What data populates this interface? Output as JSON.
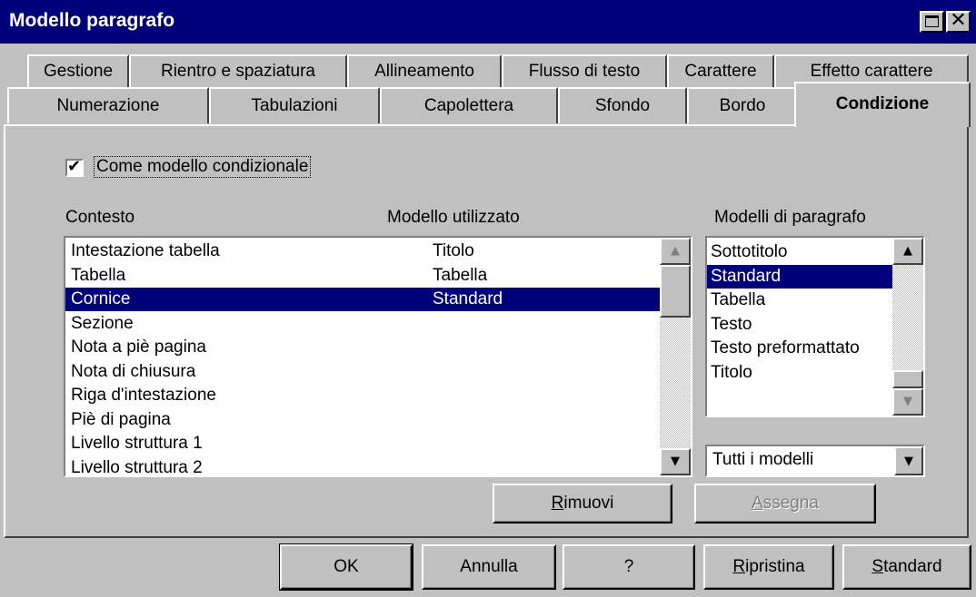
{
  "window": {
    "title": "Modello paragrafo",
    "close_glyph": "✕"
  },
  "tabs": {
    "row1": [
      "Gestione",
      "Rientro e spaziatura",
      "Allineamento",
      "Flusso di testo",
      "Carattere",
      "Effetto carattere"
    ],
    "row2": [
      "Numerazione",
      "Tabulazioni",
      "Capolettera",
      "Sfondo",
      "Bordo",
      "Condizione"
    ],
    "active": "Condizione"
  },
  "condition": {
    "checkbox": {
      "label": "Come modello condizionale",
      "checked": true,
      "mark": "✔"
    },
    "context_header": "Contesto",
    "used_style_header": "Modello utilizzato",
    "styles_header": "Modelli di paragrafo",
    "context_rows": [
      {
        "context": "Intestazione tabella",
        "style": "Titolo"
      },
      {
        "context": "Tabella",
        "style": "Tabella"
      },
      {
        "context": "Cornice",
        "style": "Standard"
      },
      {
        "context": "Sezione",
        "style": ""
      },
      {
        "context": "Nota a piè pagina",
        "style": ""
      },
      {
        "context": "Nota di chiusura",
        "style": ""
      },
      {
        "context": "Riga d'intestazione",
        "style": ""
      },
      {
        "context": "Piè di pagina",
        "style": ""
      },
      {
        "context": "Livello struttura 1",
        "style": ""
      },
      {
        "context": "Livello struttura 2",
        "style": ""
      }
    ],
    "selected_context": "Cornice",
    "paragraph_styles": [
      "Sottotitolo",
      "Standard",
      "Tabella",
      "Testo",
      "Testo preformattato",
      "Titolo"
    ],
    "selected_style": "Standard",
    "filter_value": "Tutti i modelli",
    "remove_label": "Rimuovi",
    "assign_label": "Assegna"
  },
  "scroll_glyphs": {
    "up": "▲",
    "down": "▼"
  },
  "footer": {
    "ok": "OK",
    "cancel": "Annulla",
    "help": "?",
    "reset": "Ripristina",
    "standard": "Standard"
  }
}
